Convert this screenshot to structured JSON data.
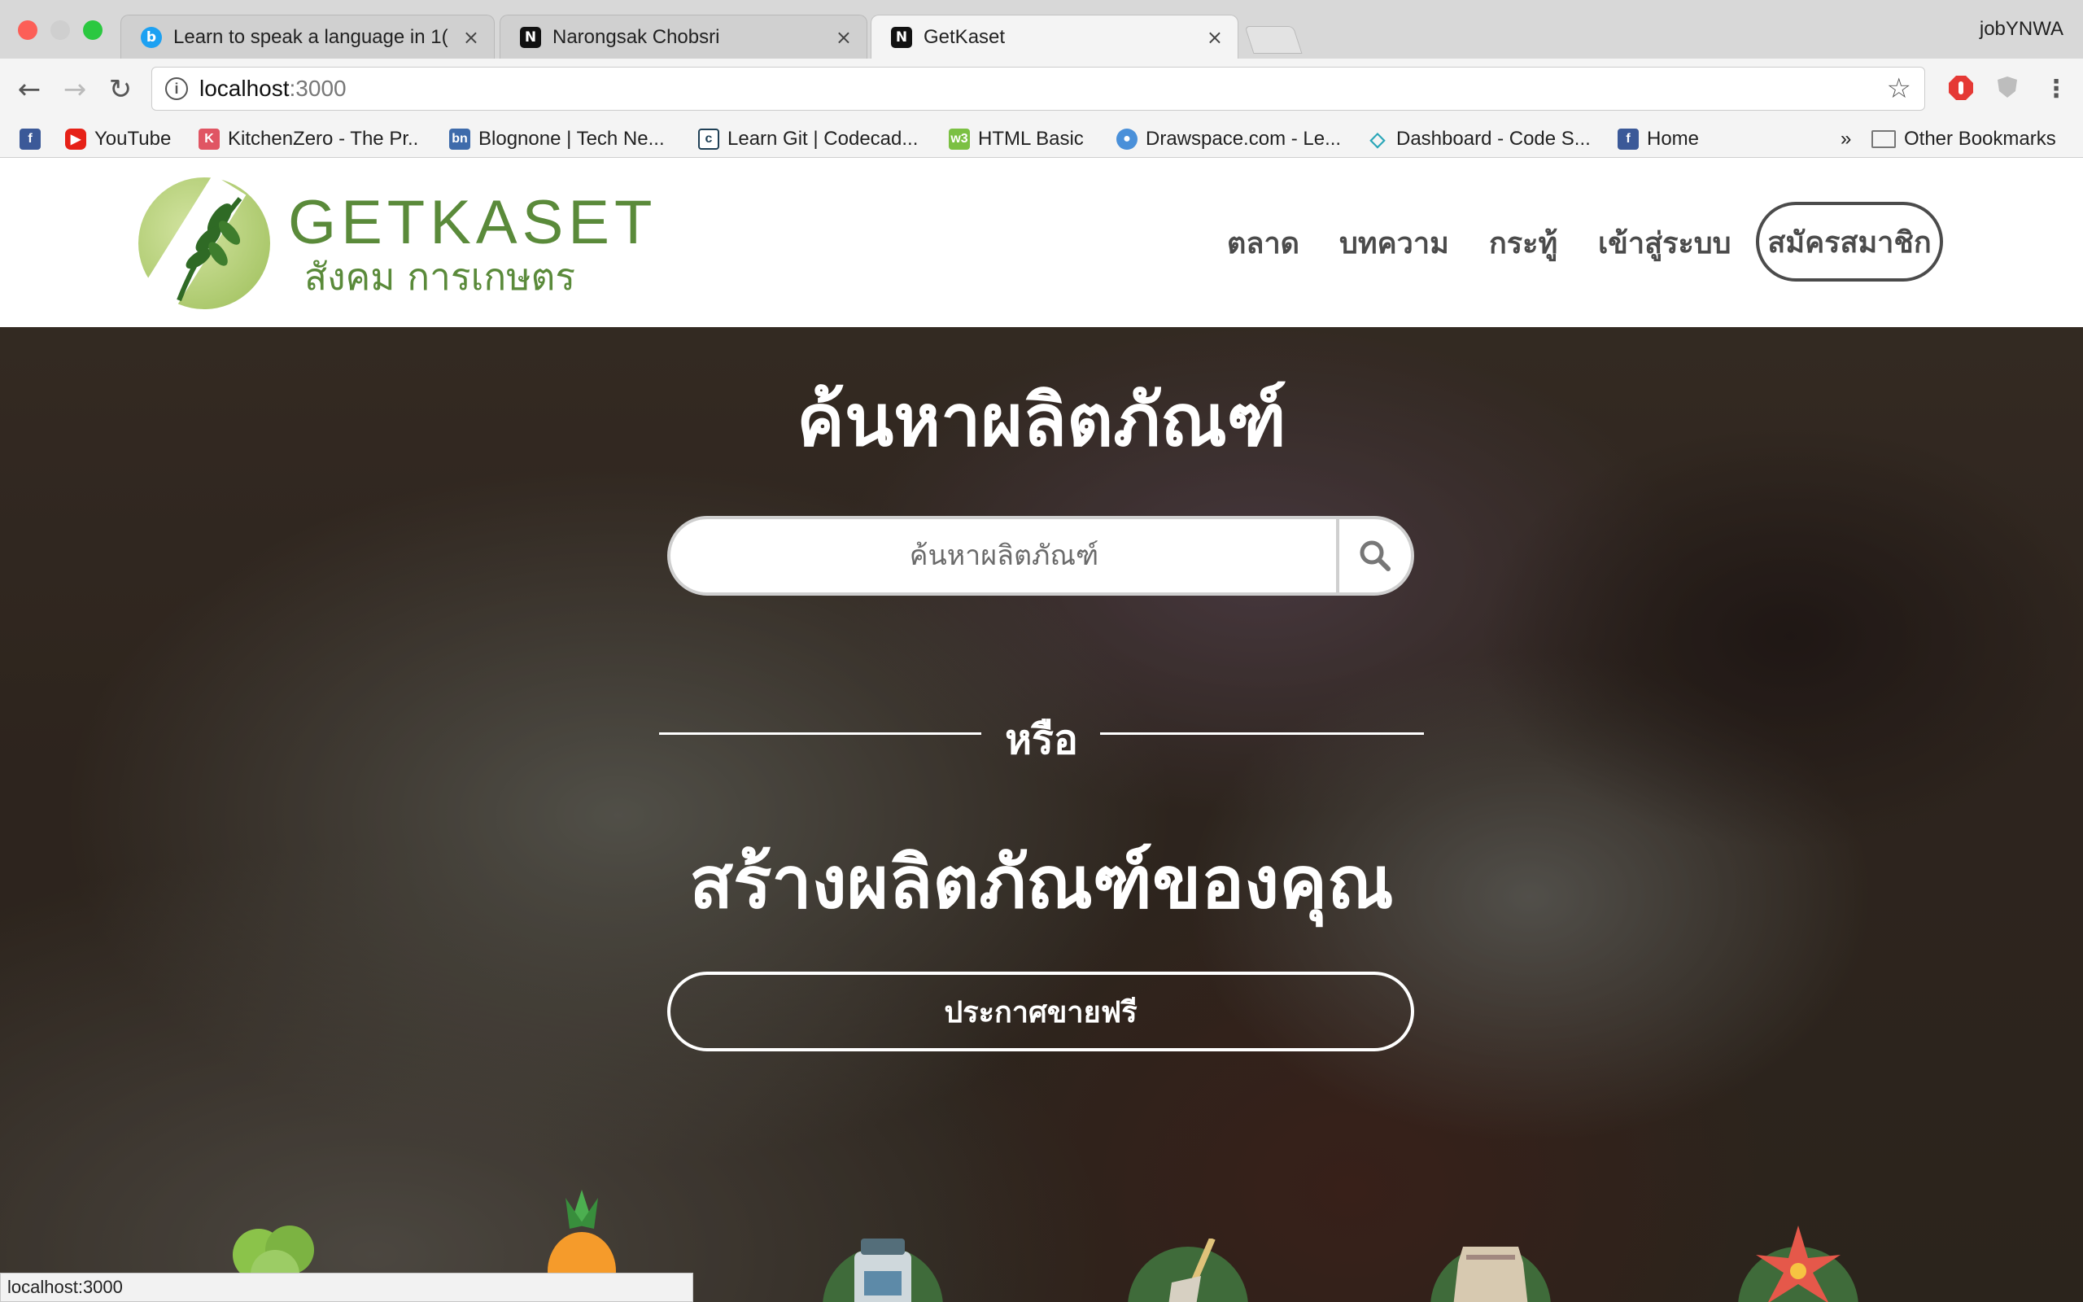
{
  "browser": {
    "tabs": [
      {
        "title": "Learn to speak a language in 1(",
        "favicon": "b"
      },
      {
        "title": "Narongsak Chobsri",
        "favicon": "N"
      },
      {
        "title": "GetKaset",
        "favicon": "N"
      }
    ],
    "profile": "jobYNWA",
    "url_host": "localhost",
    "url_port": ":3000",
    "bookmarks": [
      "YouTube",
      "KitchenZero - The Pr..",
      "Blognone | Tech Ne...",
      "Learn Git | Codecad...",
      "HTML Basic",
      "Drawspace.com - Le...",
      "Dashboard - Code S...",
      "Home"
    ],
    "bookmarks_overflow": "»",
    "other_bookmarks": "Other Bookmarks",
    "status_url": "localhost:3000"
  },
  "site": {
    "logo_title": "GETKASET",
    "logo_subtitle": "สังคม การเกษตร",
    "nav": [
      "ตลาด",
      "บทความ",
      "กระทู้",
      "เข้าสู่ระบบ"
    ],
    "signup": "สมัครสมาชิก"
  },
  "hero": {
    "heading": "ค้นหาผลิตภัณฑ์",
    "search_placeholder": "ค้นหาผลิตภัณฑ์",
    "or": "หรือ",
    "subheading": "สร้างผลิตภัณฑ์ของคุณ",
    "cta": "ประกาศขายฟรี"
  },
  "categories": [
    "vegetables-icon",
    "pineapple-icon",
    "jar-icon",
    "shovel-icon",
    "rice-sack-icon",
    "flower-icon"
  ],
  "colors": {
    "brand_green": "#5a8a3a",
    "nav_text": "#4b4b4b"
  }
}
